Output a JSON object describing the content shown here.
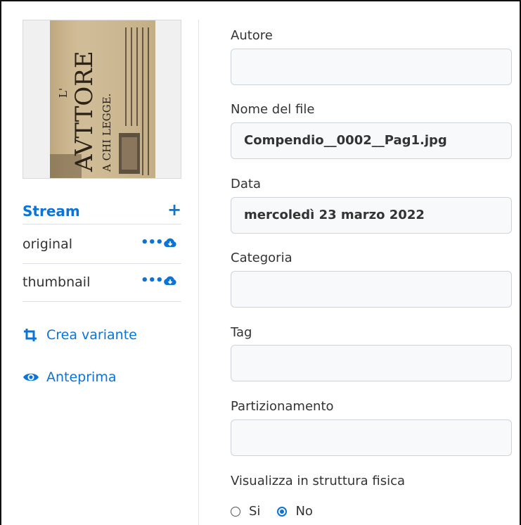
{
  "thumbnail": {
    "alt_icon": "book-page-image",
    "page_text": {
      "letter": "L'",
      "title": "AVTTORE",
      "subtitle": "A CHI LEGGE."
    }
  },
  "streams": {
    "title": "Stream",
    "add_icon": "plus-icon",
    "items": [
      {
        "name": "original",
        "more_icon": "ellipsis-icon",
        "download_icon": "cloud-download-icon"
      },
      {
        "name": "thumbnail",
        "more_icon": "ellipsis-icon",
        "download_icon": "cloud-download-icon"
      }
    ]
  },
  "actions": {
    "create_variant": "Crea variante",
    "preview": "Anteprima"
  },
  "form": {
    "author": {
      "label": "Autore",
      "value": ""
    },
    "file_name": {
      "label": "Nome del file",
      "value": "Compendio__0002__Pag1.jpg"
    },
    "date": {
      "label": "Data",
      "value": "mercoledì 23 marzo 2022"
    },
    "category": {
      "label": "Categoria",
      "value": ""
    },
    "tag": {
      "label": "Tag",
      "value": ""
    },
    "partitioning": {
      "label": "Partizionamento",
      "value": ""
    },
    "physical_structure": {
      "label": "Visualizza in struttura fisica",
      "options": [
        "Si",
        "No"
      ],
      "selected": "No"
    }
  },
  "colors": {
    "accent": "#0b74d6",
    "field_bg": "#f8f9fa",
    "border": "#ced4da"
  }
}
